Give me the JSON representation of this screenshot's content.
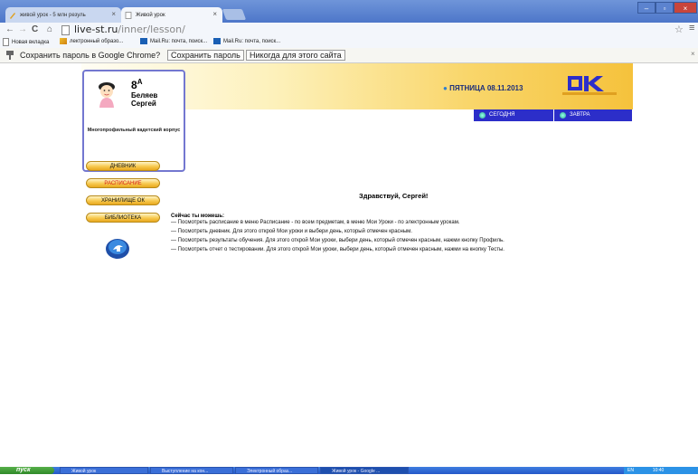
{
  "browser": {
    "tabs": [
      {
        "title": "живой урок - 5 млн резуль"
      },
      {
        "title": "Живой урок"
      }
    ],
    "url_domain": "live-st.ru",
    "url_path": "/inner/lesson/",
    "bookmarks": [
      {
        "label": "Новая вкладка"
      },
      {
        "label": "лектронный образо..."
      },
      {
        "label": "Mail.Ru: почта, поиск..."
      },
      {
        "label": "Mail.Ru: почта, поиск..."
      }
    ],
    "password_bar": {
      "text": "Сохранить пароль в Google Chrome?",
      "save_label": "Сохранить пароль",
      "never_label": "Никогда для этого сайта"
    }
  },
  "profile": {
    "grade": "8",
    "grade_sup": "А",
    "surname": "Беляев",
    "name": "Сергей",
    "school": "Многопрофильный кадетский корпус"
  },
  "header": {
    "date": "ПЯТНИЦА 08.11.2013",
    "today_label": "СЕГОДНЯ",
    "tomorrow_label": "ЗАВТРА"
  },
  "menu": [
    {
      "label": "ДНЕВНИК"
    },
    {
      "label": "РАСПИСАНИЕ"
    },
    {
      "label": "ХРАНИЛИЩЕ ОК"
    },
    {
      "label": "БИБЛИОТЕКА"
    }
  ],
  "content": {
    "greeting": "Здравствуй, Сергей!",
    "lead": "Сейчас ты можешь:",
    "items": [
      "— Посмотреть расписание в меню Расписание - по всем предметам, в меню Мои Уроки - по электронным урокам.",
      "— Посмотреть дневник. Для этого открой Мои уроки и выбери день, который отмечен красным.",
      "— Посмотреть результаты обучения. Для этого открой Мои уроки, выбери день, который отмечен красным, нажми кнопку Профиль.",
      "— Посмотреть отчет о тестировании. Для этого открой Мои уроки, выбери день, который отмечен красным, нажми на кнопку Тесты."
    ]
  },
  "taskbar": {
    "start_label": "пуск",
    "tasks": [
      {
        "label": "Живой урок"
      },
      {
        "label": "Выступление на кон..."
      },
      {
        "label": "Электронный образ..."
      },
      {
        "label": "Живой урок - Google ..."
      }
    ],
    "tray_lang": "EN",
    "clock": "10:40"
  },
  "colors": {
    "accent_blue": "#2c2ec9",
    "menu_red": "#d6201a",
    "profile_border": "#7377d0",
    "date_text": "#1d2f7a"
  },
  "icons": {
    "back": "←",
    "forward": "→",
    "reload": "C",
    "home": "⌂",
    "star": "☆",
    "menu": "≡",
    "key": "key-icon"
  }
}
